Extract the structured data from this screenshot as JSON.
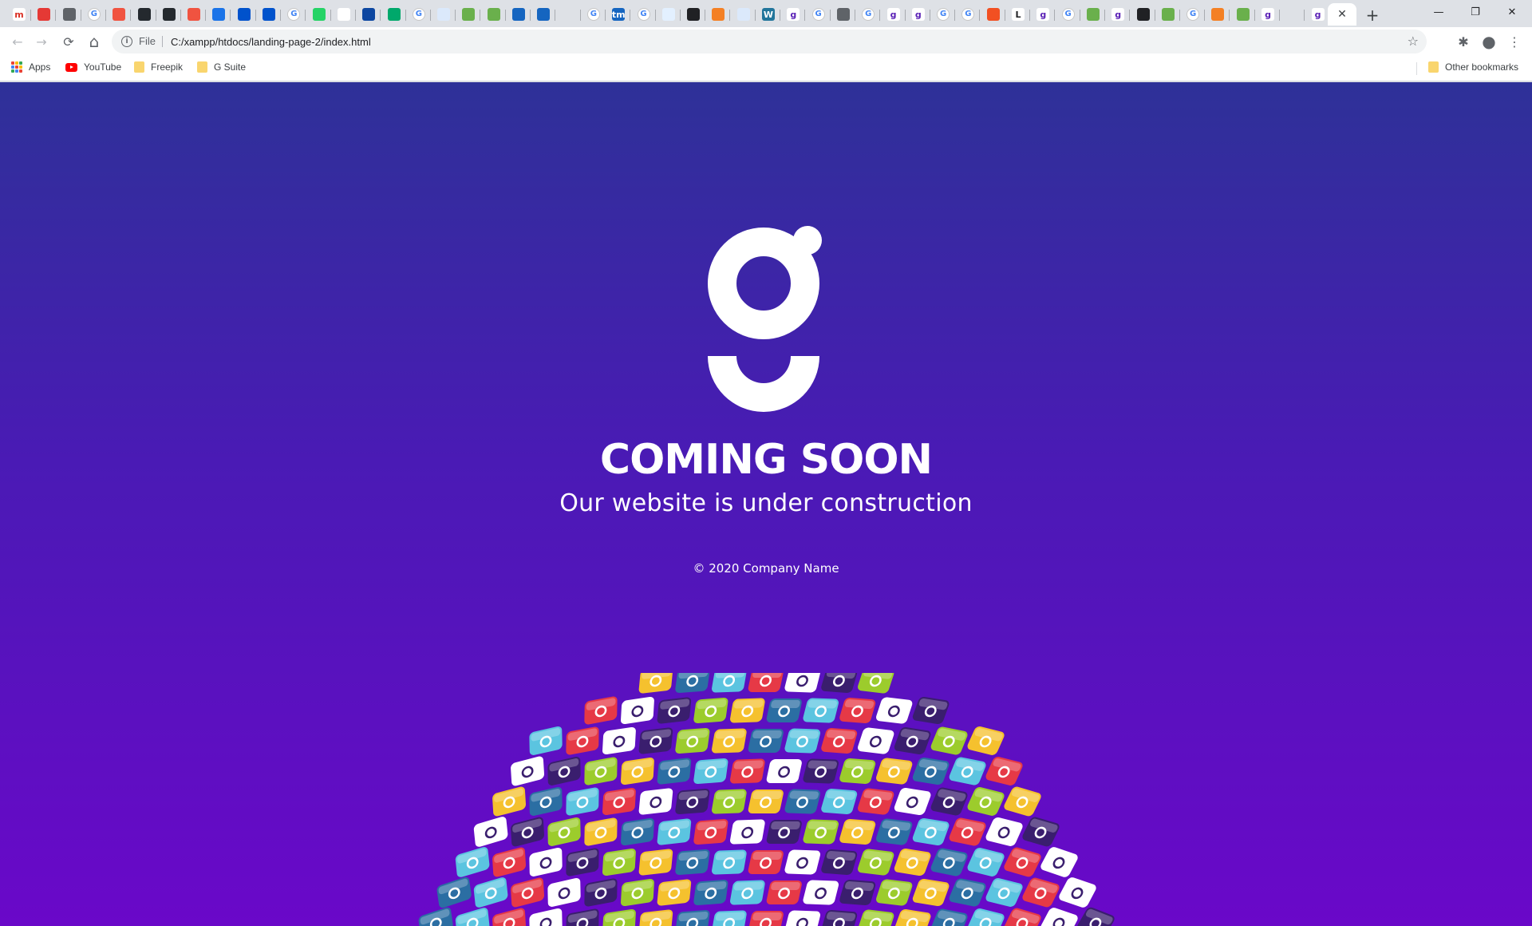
{
  "browser": {
    "tab_favicons": [
      {
        "name": "gmail-icon",
        "glyph": "m",
        "bg": "#ffffff",
        "fg": "#d93025"
      },
      {
        "name": "red-app-icon",
        "glyph": "",
        "bg": "#e53935",
        "fg": "#ffffff"
      },
      {
        "name": "globe-dark-icon",
        "glyph": "",
        "bg": "#5f6368",
        "fg": "#ffffff"
      },
      {
        "name": "google-icon",
        "glyph": "G",
        "bg": "#ffffff",
        "fg": "#4285f4"
      },
      {
        "name": "laravel-icon",
        "glyph": "",
        "bg": "#f05340",
        "fg": "#ffffff"
      },
      {
        "name": "github-icon",
        "glyph": "",
        "bg": "#24292e",
        "fg": "#ffffff"
      },
      {
        "name": "github-icon",
        "glyph": "",
        "bg": "#24292e",
        "fg": "#ffffff"
      },
      {
        "name": "laravel-icon",
        "glyph": "",
        "bg": "#f05340",
        "fg": "#ffffff"
      },
      {
        "name": "diamond-blue-icon",
        "glyph": "",
        "bg": "#1a73e8",
        "fg": "#ffffff"
      },
      {
        "name": "atlassian-icon",
        "glyph": "",
        "bg": "#0052cc",
        "fg": "#ffffff"
      },
      {
        "name": "atlassian-icon",
        "glyph": "",
        "bg": "#0052cc",
        "fg": "#ffffff"
      },
      {
        "name": "google-icon",
        "glyph": "G",
        "bg": "#ffffff",
        "fg": "#4285f4"
      },
      {
        "name": "whatsapp-icon",
        "glyph": "",
        "bg": "#25d366",
        "fg": "#ffffff"
      },
      {
        "name": "code-icon",
        "glyph": "",
        "bg": "#ffffff",
        "fg": "#1a73e8"
      },
      {
        "name": "terminal-icon",
        "glyph": "",
        "bg": "#0d47a1",
        "fg": "#ffffff"
      },
      {
        "name": "shield-green-icon",
        "glyph": "",
        "bg": "#00a86b",
        "fg": "#ffffff"
      },
      {
        "name": "google-icon",
        "glyph": "G",
        "bg": "#ffffff",
        "fg": "#4285f4"
      },
      {
        "name": "cloud-icon",
        "glyph": "",
        "bg": "#dbe9fb",
        "fg": "#4285f4"
      },
      {
        "name": "green-app-icon",
        "glyph": "",
        "bg": "#6ab04c",
        "fg": "#ffffff"
      },
      {
        "name": "green-app-icon",
        "glyph": "",
        "bg": "#6ab04c",
        "fg": "#ffffff"
      },
      {
        "name": "slash-blue-icon",
        "glyph": "",
        "bg": "#1565c0",
        "fg": "#ffffff"
      },
      {
        "name": "slash-blue-icon",
        "glyph": "",
        "bg": "#1565c0",
        "fg": "#ffffff"
      },
      {
        "name": "home-outline-icon",
        "glyph": "",
        "bg": "#dee1e6",
        "fg": "#3c4043"
      },
      {
        "name": "google-icon",
        "glyph": "G",
        "bg": "#ffffff",
        "fg": "#4285f4"
      },
      {
        "name": "tm-icon",
        "glyph": "tm",
        "bg": "#1565c0",
        "fg": "#ffffff"
      },
      {
        "name": "google-icon",
        "glyph": "G",
        "bg": "#ffffff",
        "fg": "#4285f4"
      },
      {
        "name": "document-blue-icon",
        "glyph": "",
        "bg": "#e3f0ff",
        "fg": "#1a73e8"
      },
      {
        "name": "home-solid-icon",
        "glyph": "",
        "bg": "#202124",
        "fg": "#ffffff"
      },
      {
        "name": "stackoverflow-icon",
        "glyph": "",
        "bg": "#f48024",
        "fg": "#ffffff"
      },
      {
        "name": "cloud-icon",
        "glyph": "",
        "bg": "#dbe9fb",
        "fg": "#4285f4"
      },
      {
        "name": "wordpress-icon",
        "glyph": "W",
        "bg": "#21759b",
        "fg": "#ffffff"
      },
      {
        "name": "purple-g-icon",
        "glyph": "g",
        "bg": "#ffffff",
        "fg": "#5b21b6"
      },
      {
        "name": "google-icon",
        "glyph": "G",
        "bg": "#ffffff",
        "fg": "#4285f4"
      },
      {
        "name": "globe-dark-icon",
        "glyph": "",
        "bg": "#5f6368",
        "fg": "#ffffff"
      },
      {
        "name": "google-icon",
        "glyph": "G",
        "bg": "#ffffff",
        "fg": "#4285f4"
      },
      {
        "name": "purple-g-icon",
        "glyph": "g",
        "bg": "#ffffff",
        "fg": "#5b21b6"
      },
      {
        "name": "purple-g-icon",
        "glyph": "g",
        "bg": "#ffffff",
        "fg": "#5b21b6"
      },
      {
        "name": "google-icon",
        "glyph": "G",
        "bg": "#ffffff",
        "fg": "#4285f4"
      },
      {
        "name": "google-icon",
        "glyph": "G",
        "bg": "#ffffff",
        "fg": "#4285f4"
      },
      {
        "name": "microsoft-icon",
        "glyph": "",
        "bg": "#f25022",
        "fg": "#ffffff"
      },
      {
        "name": "letter-l-icon",
        "glyph": "L",
        "bg": "#ffffff",
        "fg": "#202124"
      },
      {
        "name": "purple-g-icon",
        "glyph": "g",
        "bg": "#ffffff",
        "fg": "#5b21b6"
      },
      {
        "name": "google-icon",
        "glyph": "G",
        "bg": "#ffffff",
        "fg": "#4285f4"
      },
      {
        "name": "green-app-icon",
        "glyph": "",
        "bg": "#6ab04c",
        "fg": "#ffffff"
      },
      {
        "name": "purple-g-icon",
        "glyph": "g",
        "bg": "#ffffff",
        "fg": "#5b21b6"
      },
      {
        "name": "home-solid-icon",
        "glyph": "",
        "bg": "#202124",
        "fg": "#ffffff"
      },
      {
        "name": "green-app-icon",
        "glyph": "",
        "bg": "#6ab04c",
        "fg": "#ffffff"
      },
      {
        "name": "google-icon",
        "glyph": "G",
        "bg": "#ffffff",
        "fg": "#4285f4"
      },
      {
        "name": "stackoverflow-icon",
        "glyph": "",
        "bg": "#f48024",
        "fg": "#ffffff"
      },
      {
        "name": "green-app-icon",
        "glyph": "",
        "bg": "#6ab04c",
        "fg": "#ffffff"
      },
      {
        "name": "purple-g-icon",
        "glyph": "g",
        "bg": "#ffffff",
        "fg": "#5b21b6"
      },
      {
        "name": "home-outline-icon",
        "glyph": "",
        "bg": "#dee1e6",
        "fg": "#3c4043"
      },
      {
        "name": "purple-g-icon",
        "glyph": "g",
        "bg": "#ffffff",
        "fg": "#5b21b6"
      }
    ],
    "active_tab_close": "✕",
    "new_tab": "+",
    "window_controls": {
      "minimize": "—",
      "restore": "❐",
      "close": "✕"
    },
    "nav": {
      "back": "←",
      "forward": "→",
      "reload": "⟳",
      "home": "⌂"
    },
    "omnibox": {
      "info": "i",
      "scheme": "File",
      "url": "C:/xampp/htdocs/landing-page-2/index.html",
      "star": "☆"
    },
    "toolbar_icons": {
      "extensions": "✱",
      "profile": "●",
      "menu": "⋮"
    },
    "bookmarks": {
      "apps": "Apps",
      "youtube": "YouTube",
      "freepik": "Freepik",
      "gsuite": "G Suite",
      "other": "Other bookmarks"
    }
  },
  "page": {
    "headline": "COMING SOON",
    "subheadline": "Our website is under construction",
    "copyright": "© 2020 Company Name"
  },
  "theme": {
    "gradient_top": "#2e3198",
    "gradient_bottom": "#6a08c9",
    "tile_colors": [
      "#f5c12e",
      "#e63946",
      "#9ccc2c",
      "#5bc4e0",
      "#3a1e6e",
      "#2b6ea3",
      "#ffffff"
    ]
  }
}
